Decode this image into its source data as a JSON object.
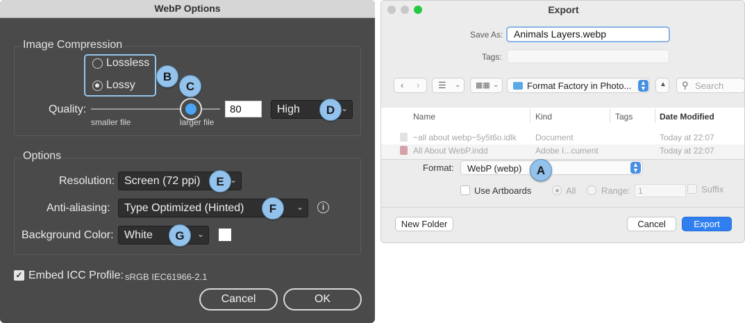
{
  "webp_dialog": {
    "title": "WebP Options",
    "compression": {
      "group_title": "Image Compression",
      "lossless_label": "Lossless",
      "lossy_label": "Lossy",
      "selected": "Lossy",
      "quality_label": "Quality:",
      "smaller_label": "smaller file",
      "larger_label": "larger file",
      "quality_value": "80",
      "quality_preset": "High",
      "slider_level": 0.76
    },
    "options": {
      "group_title": "Options",
      "resolution_label": "Resolution:",
      "resolution_value": "Screen (72 ppi)",
      "antialias_label": "Anti-aliasing:",
      "antialias_value": "Type Optimized (Hinted)",
      "bg_label": "Background Color:",
      "bg_value": "White",
      "bg_swatch_color": "#ffffff"
    },
    "embed_icc_label": "Embed ICC Profile:",
    "icc_profile": "sRGB IEC61966-2.1",
    "embed_icc_checked": true,
    "cancel_label": "Cancel",
    "ok_label": "OK",
    "callouts": {
      "b": "B",
      "c": "C",
      "d": "D",
      "e": "E",
      "f": "F",
      "g": "G"
    }
  },
  "export_dialog": {
    "title": "Export",
    "save_as_label": "Save As:",
    "save_as_value": "Animals Layers.webp",
    "tags_label": "Tags:",
    "folder_name": "Format Factory in Photo...",
    "search_placeholder": "Search",
    "columns": {
      "name": "Name",
      "kind": "Kind",
      "tags": "Tags",
      "date": "Date Modified"
    },
    "files": [
      {
        "name": "~all about webp~5y5t6o.idlk",
        "kind": "Document",
        "date": "Today at 22:07"
      },
      {
        "name": "All About WebP.indd",
        "kind": "Adobe I...cument",
        "date": "Today at 22:07"
      }
    ],
    "format_label": "Format:",
    "format_value": "WebP (webp)",
    "use_artboards_label": "Use Artboards",
    "all_label": "All",
    "range_label": "Range:",
    "range_value": "1",
    "suffix_label": "Suffix",
    "new_folder_label": "New Folder",
    "cancel_label": "Cancel",
    "export_label": "Export",
    "callout_a": "A",
    "traffic_colors": {
      "close": "#c4c4c4",
      "minimize": "#c4c4c4",
      "zoom": "#28c840"
    }
  }
}
